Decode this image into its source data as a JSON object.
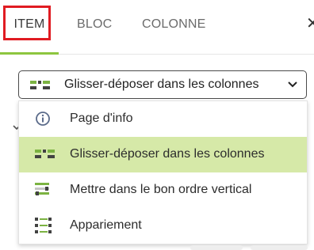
{
  "tabs": [
    {
      "label": "ITEM",
      "active": true
    },
    {
      "label": "BLOC",
      "active": false
    },
    {
      "label": "COLONNE",
      "active": false
    }
  ],
  "colors": {
    "accent": "#8dc63f",
    "highlight": "#e01b22",
    "selected_bg": "#d6e9a8"
  },
  "select": {
    "value": "Glisser-déposer dans les colonnes",
    "icon": "drag-drop-columns-icon"
  },
  "menu": {
    "options": [
      {
        "label": "Page d'info",
        "icon": "info-icon",
        "selected": false
      },
      {
        "label": "Glisser-déposer dans les colonnes",
        "icon": "drag-drop-columns-icon",
        "selected": true
      },
      {
        "label": "Mettre dans le bon ordre vertical",
        "icon": "vertical-order-icon",
        "selected": false
      },
      {
        "label": "Appariement",
        "icon": "matching-icon",
        "selected": false
      }
    ]
  }
}
